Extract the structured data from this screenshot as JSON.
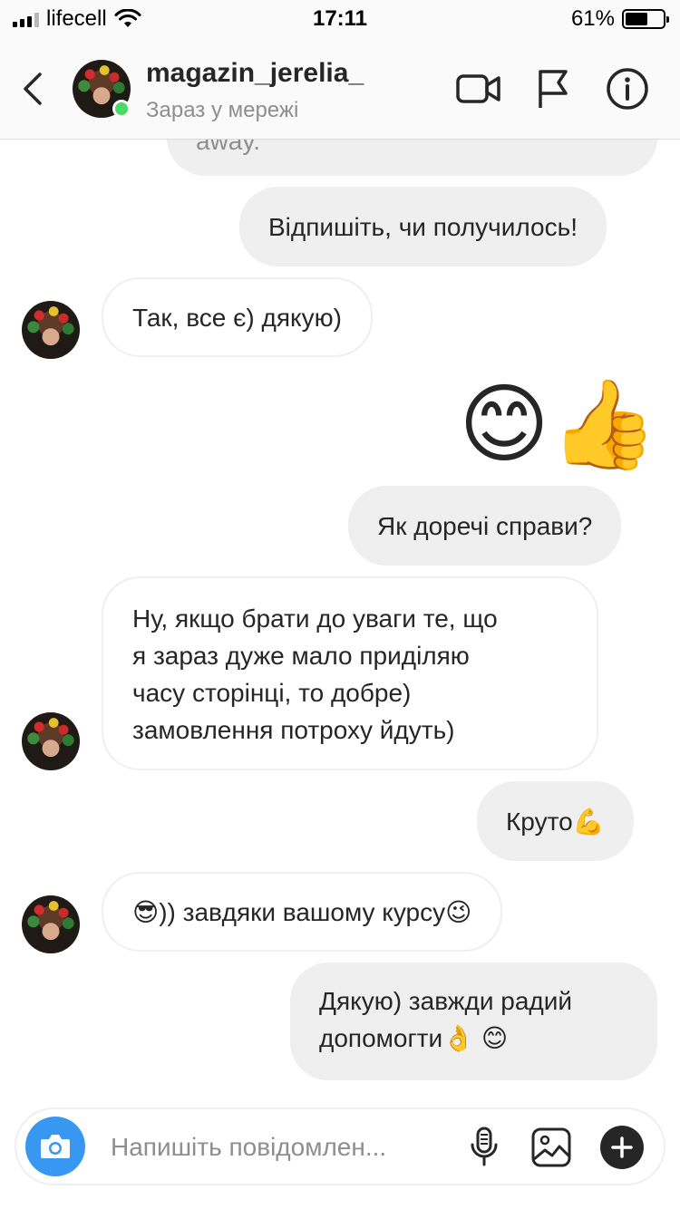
{
  "status_bar": {
    "carrier": "lifecell",
    "time": "17:11",
    "battery_percent": "61%",
    "battery_level": 0.61
  },
  "header": {
    "username": "magazin_jerelia_",
    "status": "Зараз у мережі",
    "online_color": "#4cd964"
  },
  "messages": [
    {
      "side": "out",
      "text": "away."
    },
    {
      "side": "out",
      "text": "Відпишіть, чи получилось!"
    },
    {
      "side": "in",
      "text": "Так, все є) дякую)"
    },
    {
      "side": "out",
      "type": "emoji",
      "emojis": [
        "😊",
        "👍"
      ]
    },
    {
      "side": "out",
      "text": "Як доречі справи?"
    },
    {
      "side": "in",
      "lines": [
        "Ну, якщо брати до уваги те, що",
        "я зараз дуже мало приділяю",
        "часу сторінці, то добре)",
        "замовлення потроху йдуть)"
      ]
    },
    {
      "side": "out",
      "text": "Круто",
      "emoji": "💪"
    },
    {
      "side": "in",
      "emoji_start": "😎",
      "text": " )) завдяки вашому курсу",
      "emoji_end": "😉"
    },
    {
      "side": "out",
      "line1": "Дякую) завжди радий",
      "line2": "допомогти",
      "emoji_a": "👌",
      "emoji_b": "😊"
    }
  ],
  "composer": {
    "placeholder": "Напишіть повідомлен..."
  },
  "icons": {
    "back": "chevron-left-icon",
    "video": "video-camera-icon",
    "flag": "flag-icon",
    "info": "info-icon",
    "camera": "camera-icon",
    "mic": "microphone-icon",
    "gallery": "image-icon",
    "plus": "plus-icon"
  },
  "colors": {
    "accent_blue": "#3897f0",
    "bubble_out": "#efefef",
    "text_secondary": "#8e8e8e"
  }
}
